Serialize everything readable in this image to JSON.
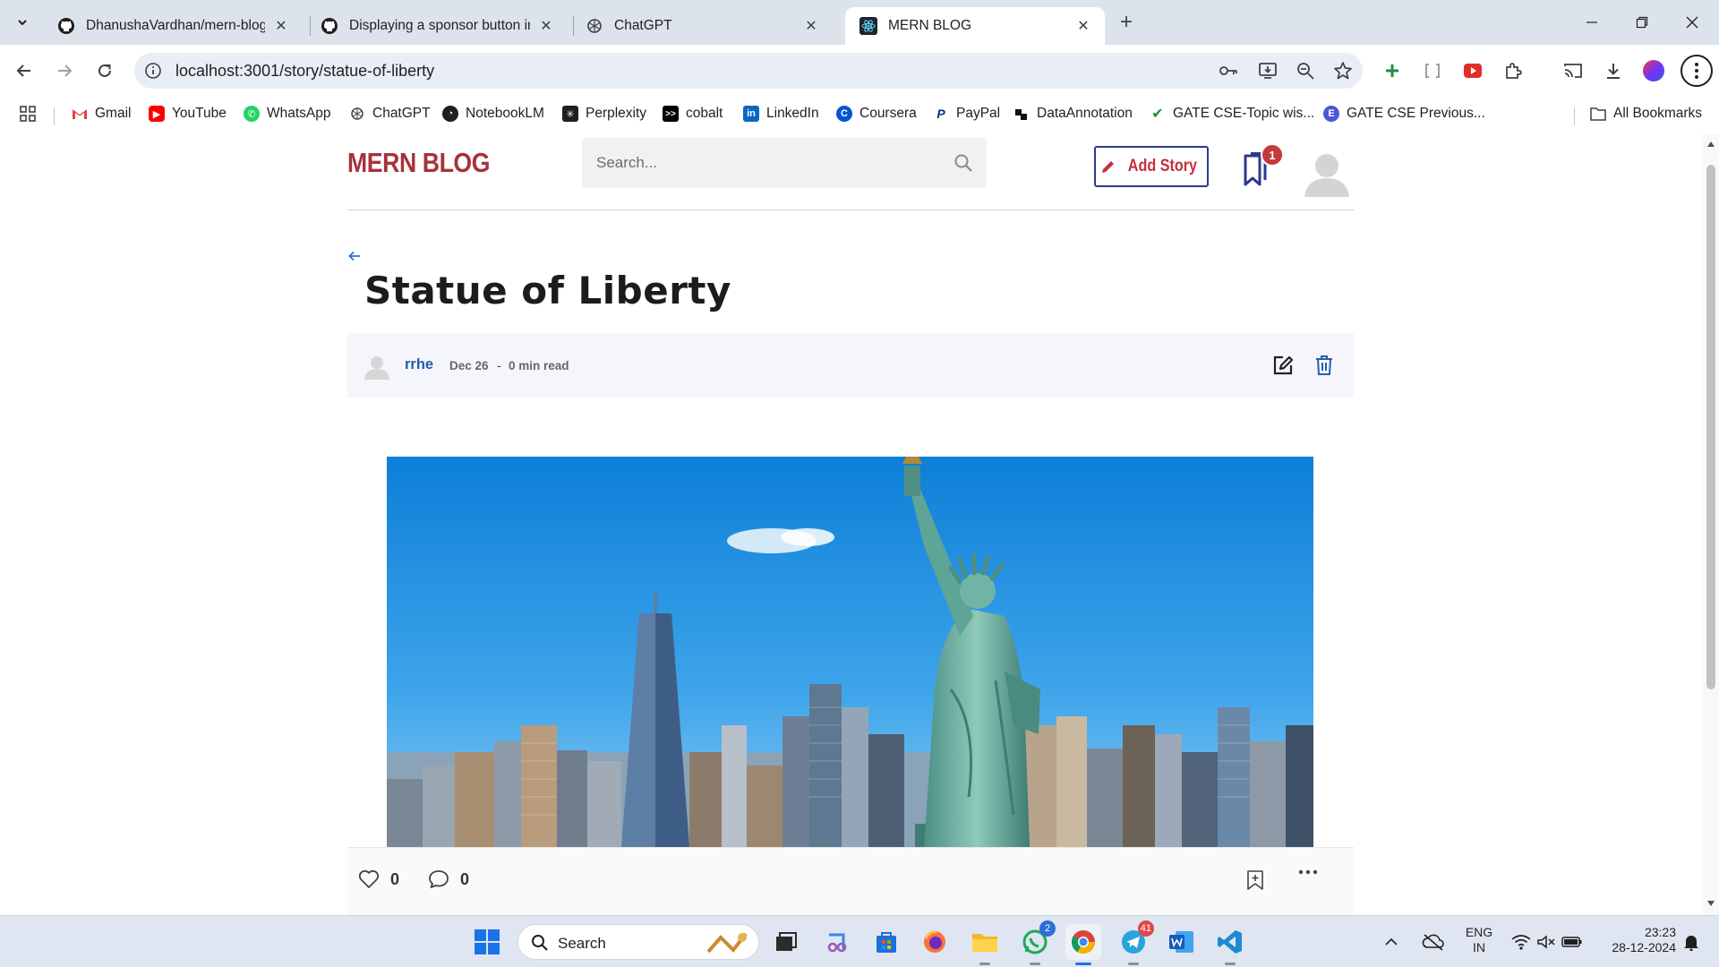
{
  "browser": {
    "tabs": [
      {
        "title": "DhanushaVardhan/mern-blog",
        "icon": "github-icon",
        "active": false
      },
      {
        "title": "Displaying a sponsor button in",
        "icon": "github-icon",
        "active": false
      },
      {
        "title": "ChatGPT",
        "icon": "chatgpt-icon",
        "active": false
      },
      {
        "title": "MERN BLOG",
        "icon": "react-icon",
        "active": true
      }
    ],
    "url": "localhost:3001/story/statue-of-liberty",
    "bookmarks": [
      {
        "label": "Gmail",
        "color": "#ea4335"
      },
      {
        "label": "YouTube",
        "color": "#ff0000"
      },
      {
        "label": "WhatsApp",
        "color": "#25d366"
      },
      {
        "label": "ChatGPT",
        "color": "#444444"
      },
      {
        "label": "NotebookLM",
        "color": "#1f1f1f"
      },
      {
        "label": "Perplexity",
        "color": "#1f1f1f"
      },
      {
        "label": "cobalt",
        "color": "#000000"
      },
      {
        "label": "LinkedIn",
        "color": "#0a66c2"
      },
      {
        "label": "Coursera",
        "color": "#0056d2"
      },
      {
        "label": "PayPal",
        "color": "#003087"
      },
      {
        "label": "DataAnnotation",
        "color": "#111111"
      },
      {
        "label": "GATE CSE-Topic wis...",
        "color": "#1e8e3e"
      },
      {
        "label": "GATE CSE Previous...",
        "color": "#4a57d8"
      }
    ],
    "all_bookmarks": "All Bookmarks"
  },
  "site": {
    "logo": "MERN BLOG",
    "search_placeholder": "Search...",
    "add_story_label": "Add Story",
    "readlist_count": "1",
    "brand_color": "#a8323a"
  },
  "story": {
    "title": "Statue of Liberty",
    "author": "rrhe",
    "date": "Dec 26",
    "separator": "-",
    "read_time": "0 min read",
    "likes": "0",
    "comments": "0"
  },
  "taskbar": {
    "search_label": "Search",
    "whatsapp_badge": "2",
    "telegram_badge": "41",
    "language_line1": "ENG",
    "language_line2": "IN",
    "time": "23:23",
    "date": "28-12-2024"
  }
}
